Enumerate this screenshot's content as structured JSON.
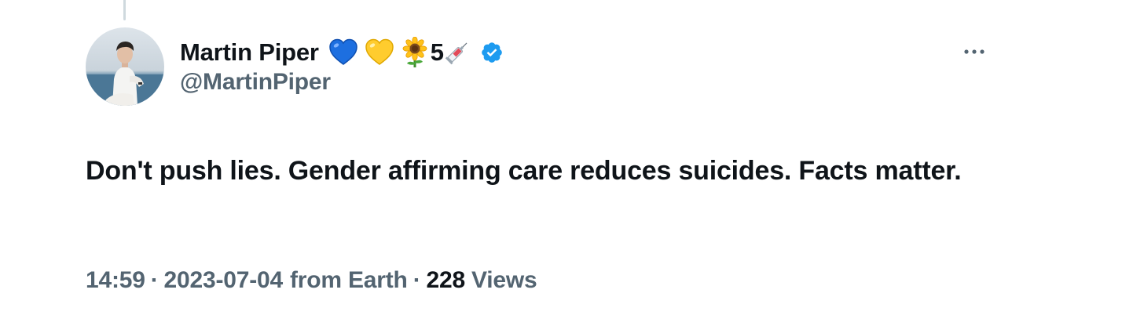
{
  "tweet": {
    "author": {
      "display_name": "Martin Piper",
      "badges": [
        "blue-heart",
        "yellow-heart",
        "sunflower"
      ],
      "vaccine_count": "5",
      "verified": true,
      "handle": "@MartinPiper"
    },
    "text": "Don't push lies. Gender affirming care reduces suicides. Facts matter.",
    "meta": {
      "time": "14:59",
      "separator": "·",
      "date": "2023-07-04",
      "source": "from Earth",
      "views_count": "228",
      "views_label": "Views"
    }
  },
  "colors": {
    "text_primary": "#0f1419",
    "text_secondary": "#536471",
    "verified_blue": "#1d9bf0",
    "thread_line": "#cfd9de"
  },
  "icons": {
    "more": "more-dots-icon",
    "verified": "verified-badge-icon",
    "vaccine": "syringe-icon"
  }
}
